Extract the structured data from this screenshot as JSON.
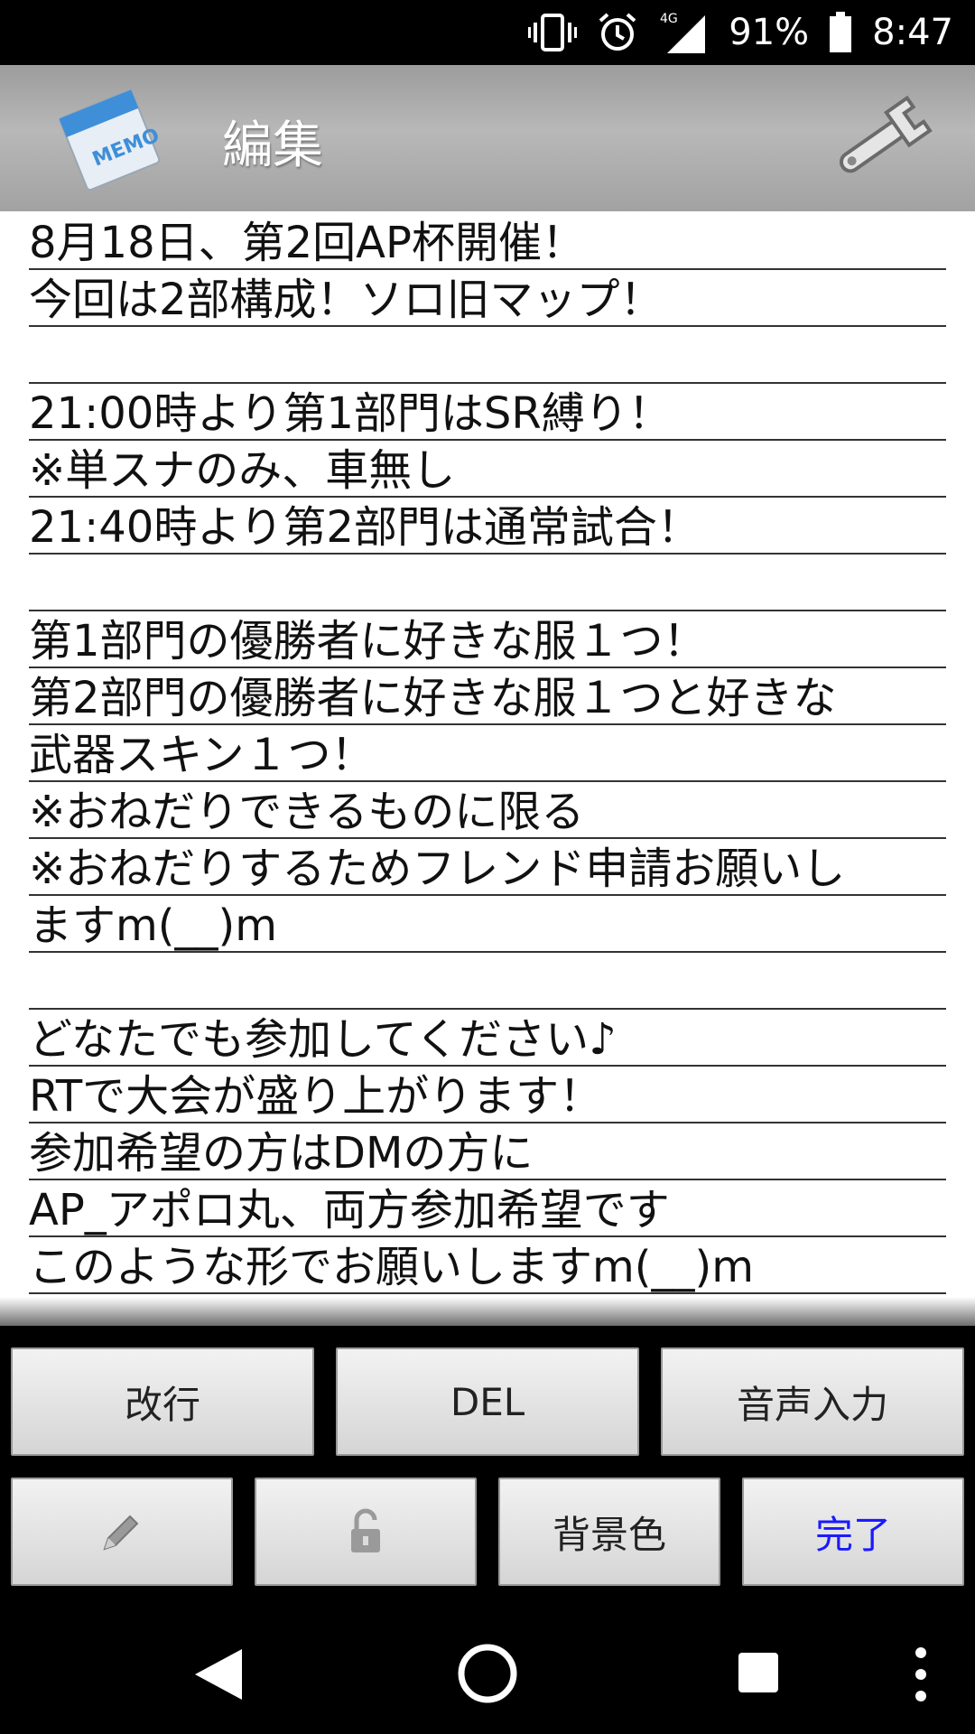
{
  "status": {
    "battery": "91%",
    "time": "8:47",
    "network": "4G"
  },
  "icons": {
    "vibrate": "vibrate-icon",
    "alarm": "alarm-icon",
    "signal": "signal-icon",
    "battery": "battery-icon",
    "memo": "memo-pad-icon",
    "settings": "wrench-icon",
    "edit": "pencil-icon",
    "lock": "unlock-icon"
  },
  "header": {
    "title": "編集"
  },
  "memo": {
    "lines": [
      "8月18日、第2回AP杯開催！",
      "今回は2部構成！ソロ旧マップ！",
      "",
      "21:00時より第1部門はSR縛り！",
      "※単スナのみ、車無し",
      "21:40時より第2部門は通常試合！",
      "",
      "第1部門の優勝者に好きな服１つ！",
      "第2部門の優勝者に好きな服１つと好きな",
      "武器スキン１つ！",
      "※おねだりできるものに限る",
      "※おねだりするためフレンド申請お願いし",
      "ますm(__)m",
      "",
      "どなたでも参加してください♪",
      "RTで大会が盛り上がります！",
      "参加希望の方はDMの方に",
      "AP_アポロ丸、両方参加希望です",
      "このような形でお願いしますm(__)m"
    ]
  },
  "buttons": {
    "newline": "改行",
    "del": "DEL",
    "voice": "音声入力",
    "bgcolor": "背景色",
    "done": "完了"
  },
  "colors": {
    "done_text": "#1a1aff",
    "appbar": "#aaaaaa",
    "rule_line": "#333333"
  }
}
